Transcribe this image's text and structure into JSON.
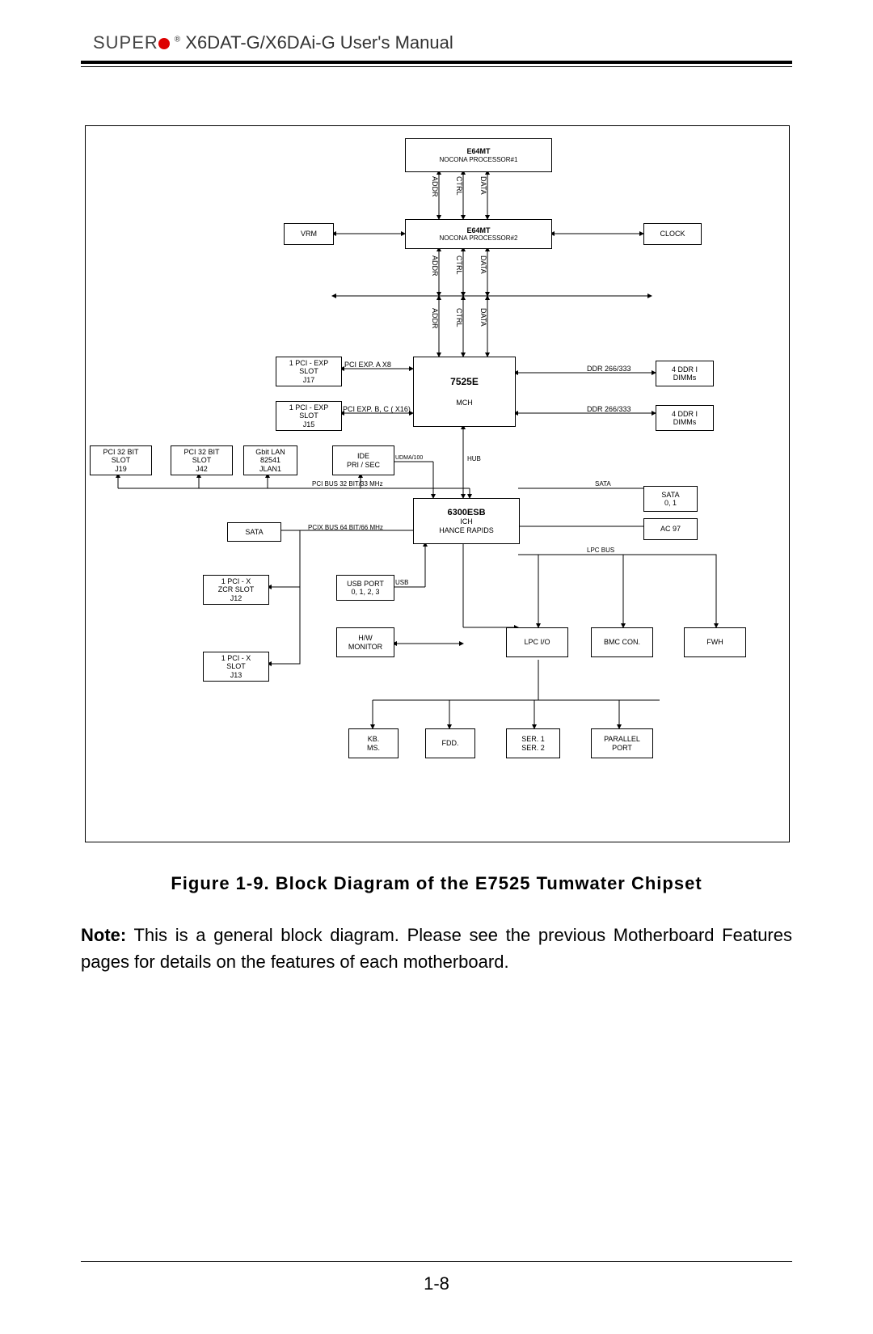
{
  "header": {
    "brand": "SUPER",
    "title": " X6DAT-G/X6DAi-G User's Manual"
  },
  "figure_caption": "Figure 1-9.    Block Diagram of the E7525 Tumwater Chipset",
  "note": {
    "b": "Note:",
    "t": " This is a general block diagram.  Please see the previous Motherboard Features pages for details on the features of each motherboard."
  },
  "page_no": "1-8",
  "blocks": {
    "cpu1": {
      "l1": "E64MT",
      "l2": "NOCONA PROCESSOR#1"
    },
    "cpu2": {
      "l1": "E64MT",
      "l2": "NOCONA PROCESSOR#2"
    },
    "vrm": "VRM",
    "clock": "CLOCK",
    "mch": {
      "l1": "7525E",
      "l2": "MCH"
    },
    "pex1": {
      "l1": "1  PCI - EXP",
      "l2": "SLOT",
      "l3": "J17"
    },
    "pex2": {
      "l1": "1  PCI - EXP",
      "l2": "SLOT",
      "l3": "J15"
    },
    "dimm1": {
      "l1": "4  DDR I",
      "l2": "DIMMs"
    },
    "dimm2": {
      "l1": "4  DDR  I",
      "l2": "DIMMs"
    },
    "pci1": {
      "l1": "PCI  32 BIT",
      "l2": "SLOT",
      "l3": "J19"
    },
    "pci2": {
      "l1": "PCI  32 BIT",
      "l2": "SLOT",
      "l3": "J42"
    },
    "lan": {
      "l1": "Gbit  LAN",
      "l2": "82541",
      "l3": "JLAN1"
    },
    "ide": {
      "l1": "IDE",
      "l2": "PRI / SEC"
    },
    "ich": {
      "l1": "6300ESB",
      "l2": "ICH",
      "l3": "HANCE RAPIDS"
    },
    "sata1": {
      "l1": "SATA",
      "l2": "0, 1"
    },
    "ac97": "AC 97",
    "sata2": "SATA",
    "zcr": {
      "l1": "1  PCI - X",
      "l2": "ZCR SLOT",
      "l3": "J12"
    },
    "pcix": {
      "l1": "1  PCI - X",
      "l2": "SLOT",
      "l3": "J13"
    },
    "usb": {
      "l1": "USB PORT",
      "l2": "0, 1, 2, 3"
    },
    "hw": {
      "l1": "H/W",
      "l2": "MONITOR"
    },
    "lpc": "LPC I/O",
    "bmc": "BMC CON.",
    "fwh": "FWH",
    "kb": {
      "l1": "KB.",
      "l2": "MS."
    },
    "fdd": "FDD.",
    "ser": {
      "l1": "SER. 1",
      "l2": "SER. 2"
    },
    "par": {
      "l1": "PARALLEL",
      "l2": "PORT"
    }
  },
  "bus_labels": {
    "addr": "ADDR",
    "ctrl": "CTRL",
    "data": "DATA",
    "pexa": "PCI  EXP.  A    X8",
    "pexb": "PCI  EXP.  B, C ( X16)",
    "ddr": "DDR 266/333",
    "udma": "UDMA/100",
    "hub": "HUB",
    "sata": "SATA",
    "pcib": "PCI  BUS  32 BIT/33 MHz",
    "pcixb": "PCIX BUS 64 BIT/66 MHz",
    "usb": "USB",
    "lpc": "LPC BUS"
  }
}
